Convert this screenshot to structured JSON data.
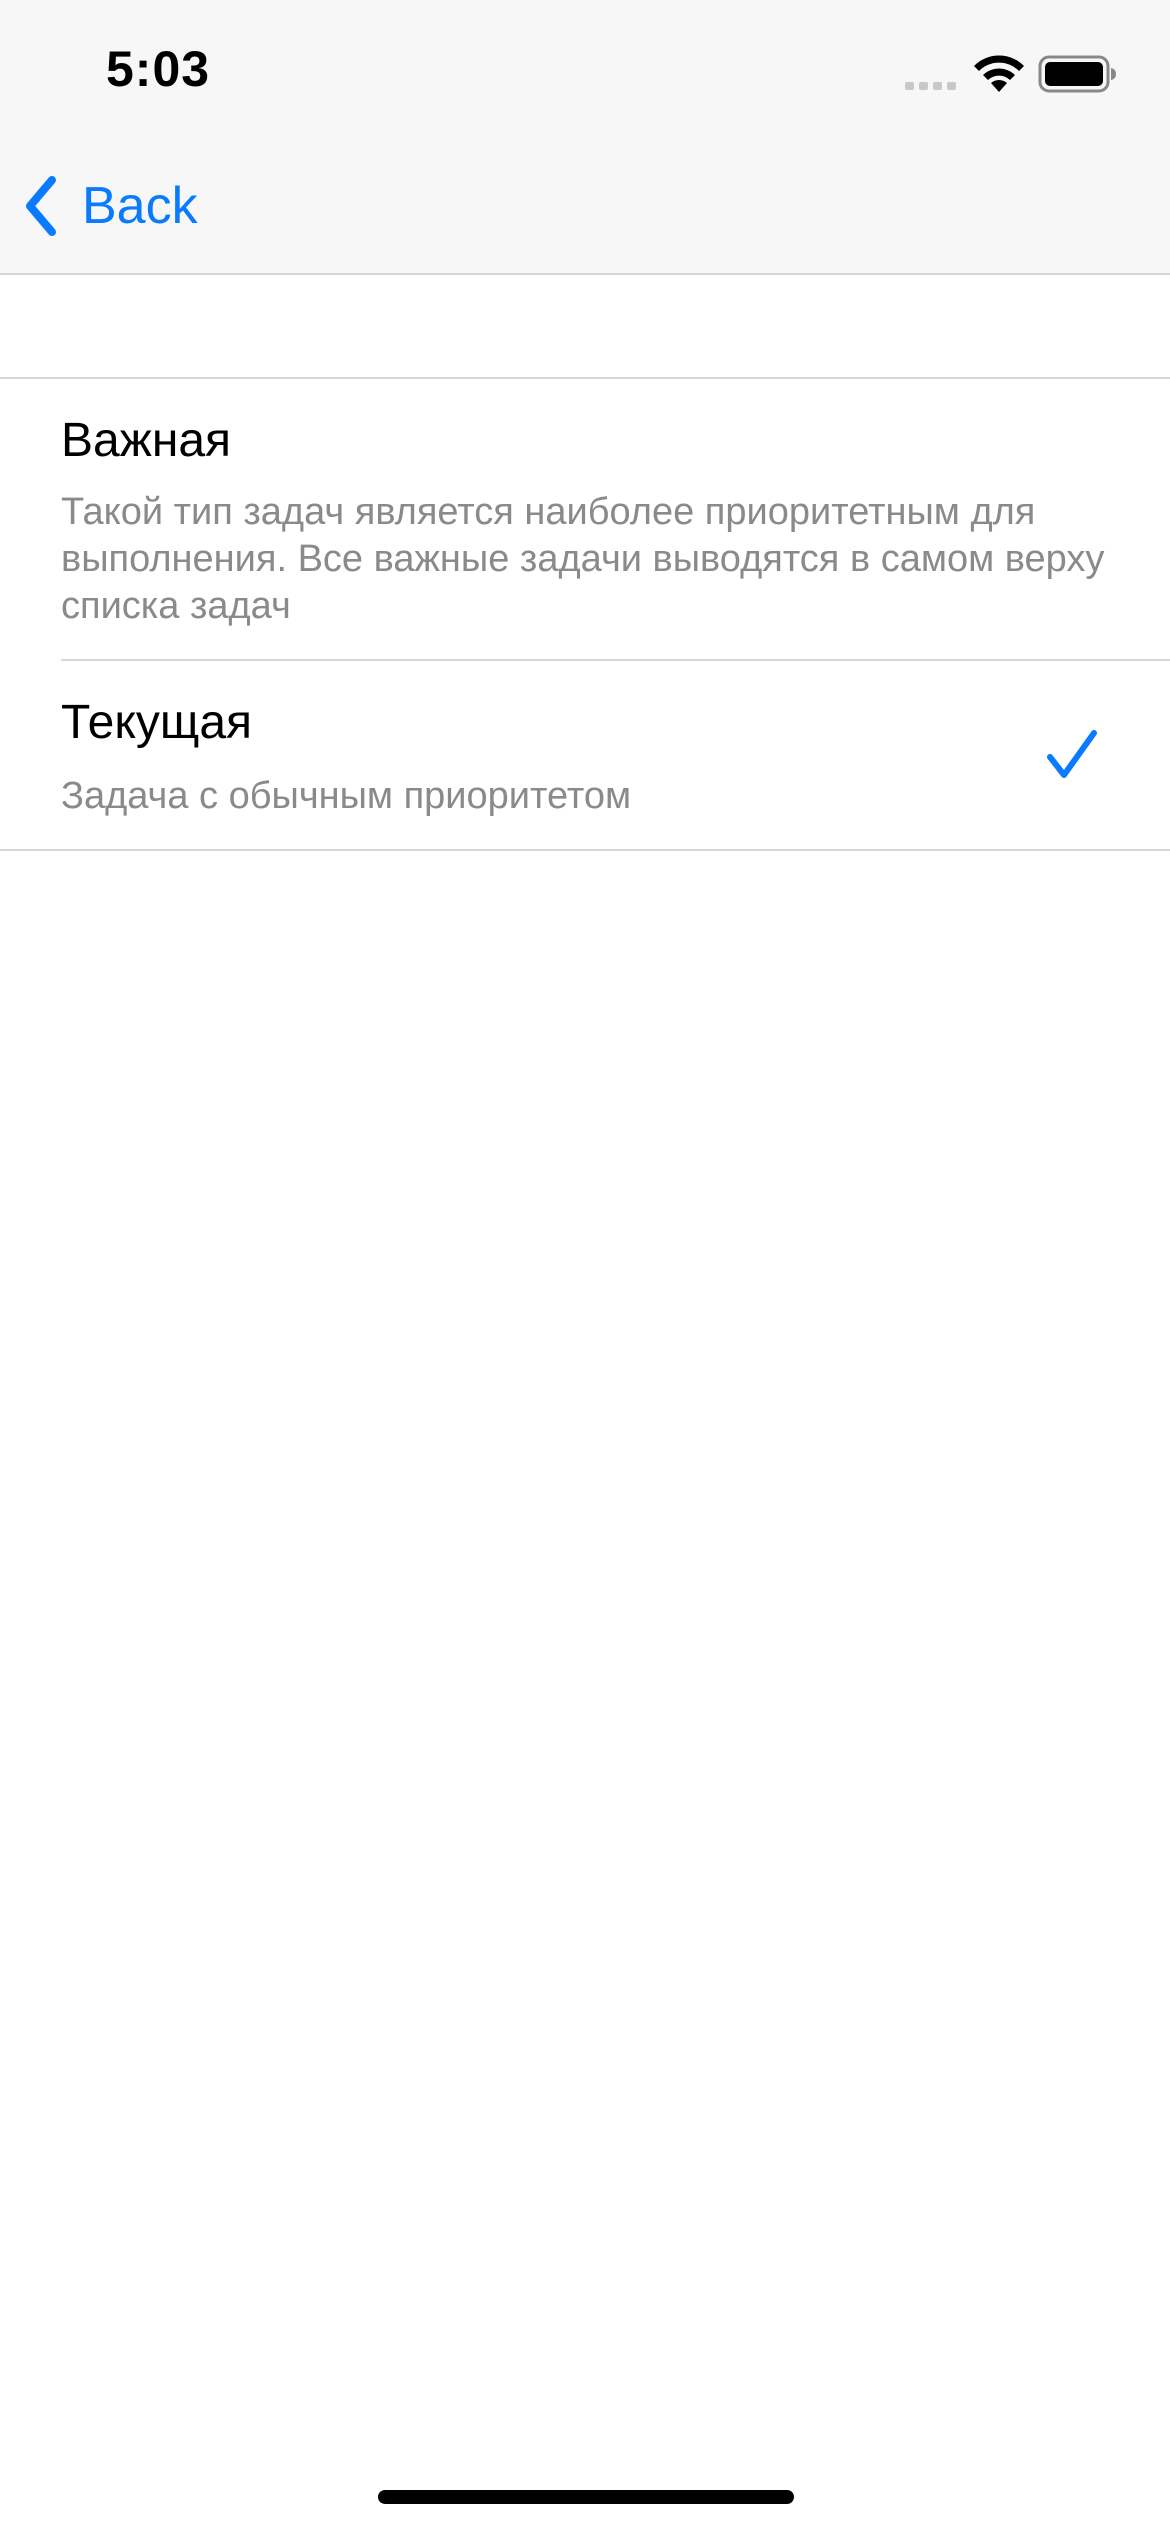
{
  "status_bar": {
    "time": "5:03",
    "icons": [
      "signal-icon",
      "wifi-icon",
      "battery-icon"
    ]
  },
  "nav": {
    "back_label": "Back",
    "back_icon": "chevron-left-icon"
  },
  "options": [
    {
      "title": "Важная",
      "description": "Такой тип задач является наиболее приоритетным для выполнения. Все важные задачи выводятся в самом верху списка задач",
      "selected": false
    },
    {
      "title": "Текущая",
      "description": "Задача с обычным приоритетом",
      "selected": true,
      "accessory_icon": "checkmark-icon"
    }
  ],
  "colors": {
    "accent": "#0a7aff",
    "secondary_text": "#8a8a8e",
    "separator": "#d6d6d8",
    "nav_background": "#f7f7f7"
  }
}
